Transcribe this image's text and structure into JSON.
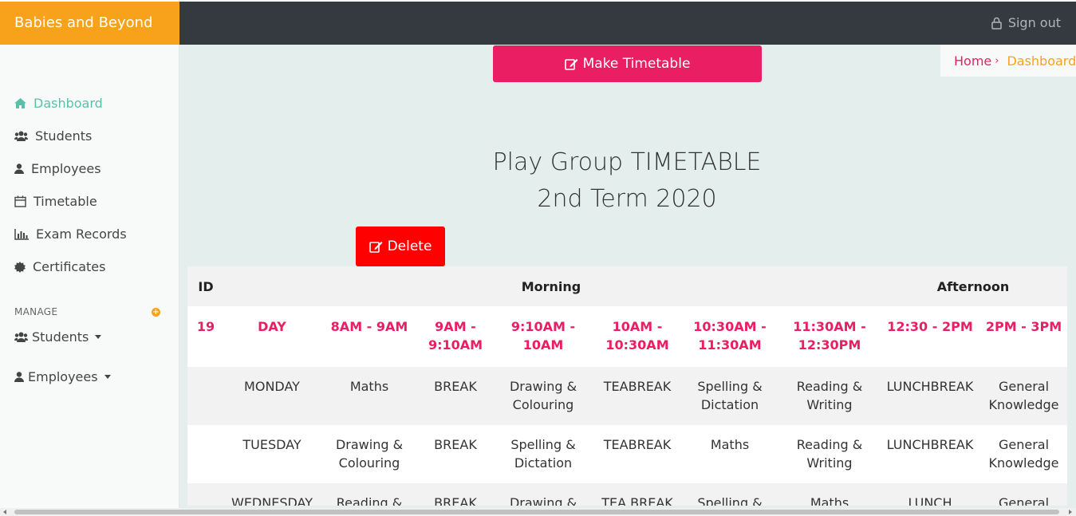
{
  "brand": "Babies and Beyond",
  "header": {
    "signout_label": "Sign out"
  },
  "sidebar": {
    "items": [
      {
        "label": "Dashboard",
        "icon": "home-icon",
        "active": true
      },
      {
        "label": "Students",
        "icon": "users-icon"
      },
      {
        "label": "Employees",
        "icon": "user-icon"
      },
      {
        "label": "Timetable",
        "icon": "calendar-icon"
      },
      {
        "label": "Exam Records",
        "icon": "bar-chart-icon"
      },
      {
        "label": "Certificates",
        "icon": "certificate-icon"
      }
    ],
    "manage_label": "MANAGE",
    "manage_items": [
      {
        "label": "Students",
        "icon": "users-icon"
      },
      {
        "label": "Employees",
        "icon": "user-icon"
      }
    ]
  },
  "main": {
    "make_timetable_label": "Make Timetable",
    "breadcrumb": {
      "home": "Home",
      "current": "Dashboard"
    },
    "title_line1": "Play Group TIMETABLE",
    "title_line2": "2nd Term 2020",
    "delete_label": "Delete"
  },
  "table": {
    "header": {
      "id": "ID",
      "morning": "Morning",
      "afternoon": "Afternoon"
    },
    "time_row": [
      "19",
      "DAY",
      "8AM - 9AM",
      "9AM - 9:10AM",
      "9:10AM - 10AM",
      "10AM - 10:30AM",
      "10:30AM - 11:30AM",
      "11:30AM - 12:30PM",
      "12:30 - 2PM",
      "2PM - 3PM"
    ],
    "rows": [
      [
        "",
        "MONDAY",
        "Maths",
        "BREAK",
        "Drawing & Colouring",
        "TEABREAK",
        "Spelling & Dictation",
        "Reading & Writing",
        "LUNCHBREAK",
        "General Knowledge"
      ],
      [
        "",
        "TUESDAY",
        "Drawing & Colouring",
        "BREAK",
        "Spelling & Dictation",
        "TEABREAK",
        "Maths",
        "Reading & Writing",
        "LUNCHBREAK",
        "General Knowledge"
      ],
      [
        "",
        "WEDNESDAY",
        "Reading &",
        "BREAK",
        "Drawing &",
        "TEA BREAK",
        "Spelling &",
        "Maths",
        "LUNCH",
        "General"
      ]
    ]
  },
  "colors": {
    "brand": "#f7a21a",
    "accent": "#e91e63",
    "danger": "#ff0000",
    "active": "#5cbfa8"
  }
}
